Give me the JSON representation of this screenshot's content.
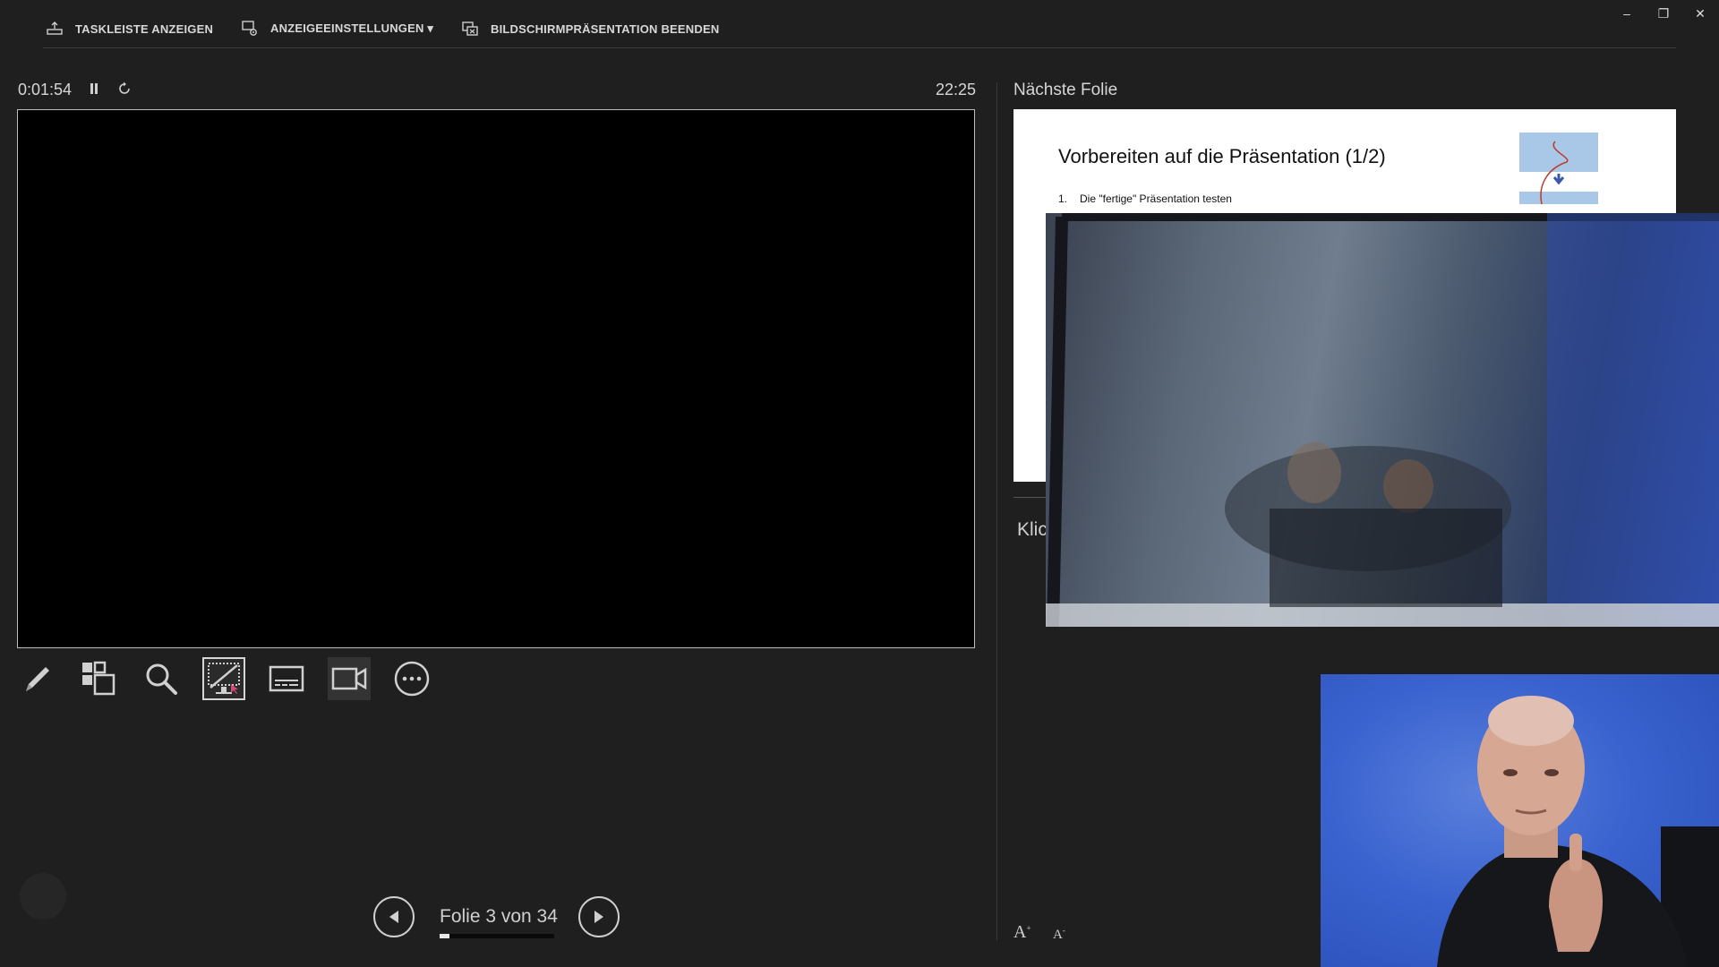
{
  "topbar": {
    "taskbar_label": "TASKLEISTE ANZEIGEN",
    "display_settings_label": "ANZEIGEEINSTELLUNGEN ▾",
    "end_show_label": "BILDSCHIRMPRÄSENTATION BEENDEN"
  },
  "window": {
    "minimize": "–",
    "restore": "❐",
    "close": "✕"
  },
  "presenter": {
    "elapsed_time": "0:01:54",
    "clock": "22:25",
    "pause_icon": "pause-icon",
    "reset_icon": "restart-icon"
  },
  "tools": [
    "pen-icon",
    "slides-grid-icon",
    "zoom-icon",
    "black-screen-icon",
    "subtitles-icon",
    "camera-icon",
    "more-options-icon"
  ],
  "navigation": {
    "slide_counter": "Folie 3 von 34",
    "current": 3,
    "total": 34
  },
  "next_slide": {
    "label": "Nächste Folie",
    "title": "Vorbereiten auf die Präsentation (1/2)",
    "item_number": "1.",
    "item_text": "Die \"fertige\" Präsentation testen"
  },
  "notes": {
    "text": "Klic"
  },
  "font_controls": {
    "increase": "A",
    "decrease": "A"
  },
  "colors": {
    "background": "#1f1f1f",
    "text": "#e6e6e6",
    "slide_bg": "#000000",
    "next_slide_bg": "#ffffff",
    "accent_pink": "#d04a7a"
  }
}
